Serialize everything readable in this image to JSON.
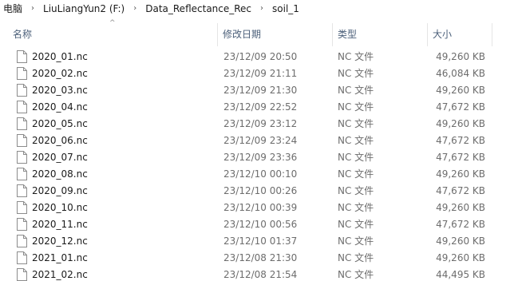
{
  "breadcrumb": {
    "items": [
      "电脑",
      "LiuLiangYun2 (F:)",
      "Data_Reflectance_Rec",
      "soil_1"
    ],
    "separator": "›"
  },
  "columns": {
    "name": "名称",
    "date": "修改日期",
    "type": "类型",
    "size": "大小",
    "sort_indicator": "^"
  },
  "files": [
    {
      "name": "2020_01.nc",
      "date": "23/12/09 20:50",
      "type": "NC 文件",
      "size": "49,260 KB"
    },
    {
      "name": "2020_02.nc",
      "date": "23/12/09 21:11",
      "type": "NC 文件",
      "size": "46,084 KB"
    },
    {
      "name": "2020_03.nc",
      "date": "23/12/09 21:30",
      "type": "NC 文件",
      "size": "49,260 KB"
    },
    {
      "name": "2020_04.nc",
      "date": "23/12/09 22:52",
      "type": "NC 文件",
      "size": "47,672 KB"
    },
    {
      "name": "2020_05.nc",
      "date": "23/12/09 23:12",
      "type": "NC 文件",
      "size": "49,260 KB"
    },
    {
      "name": "2020_06.nc",
      "date": "23/12/09 23:24",
      "type": "NC 文件",
      "size": "47,672 KB"
    },
    {
      "name": "2020_07.nc",
      "date": "23/12/09 23:36",
      "type": "NC 文件",
      "size": "47,672 KB"
    },
    {
      "name": "2020_08.nc",
      "date": "23/12/10 00:10",
      "type": "NC 文件",
      "size": "49,260 KB"
    },
    {
      "name": "2020_09.nc",
      "date": "23/12/10 00:26",
      "type": "NC 文件",
      "size": "47,672 KB"
    },
    {
      "name": "2020_10.nc",
      "date": "23/12/10 00:39",
      "type": "NC 文件",
      "size": "49,260 KB"
    },
    {
      "name": "2020_11.nc",
      "date": "23/12/10 00:56",
      "type": "NC 文件",
      "size": "47,672 KB"
    },
    {
      "name": "2020_12.nc",
      "date": "23/12/10 01:37",
      "type": "NC 文件",
      "size": "49,260 KB"
    },
    {
      "name": "2021_01.nc",
      "date": "23/12/08 21:30",
      "type": "NC 文件",
      "size": "49,260 KB"
    },
    {
      "name": "2021_02.nc",
      "date": "23/12/08 21:54",
      "type": "NC 文件",
      "size": "44,495 KB"
    }
  ],
  "icons": {
    "file": "file-icon",
    "separator": "chevron-right-icon",
    "sort": "sort-ascending-icon"
  },
  "colors": {
    "header_text": "#4c607a",
    "secondary_text": "#6d6d6d",
    "primary_text": "#1a1a1a"
  }
}
